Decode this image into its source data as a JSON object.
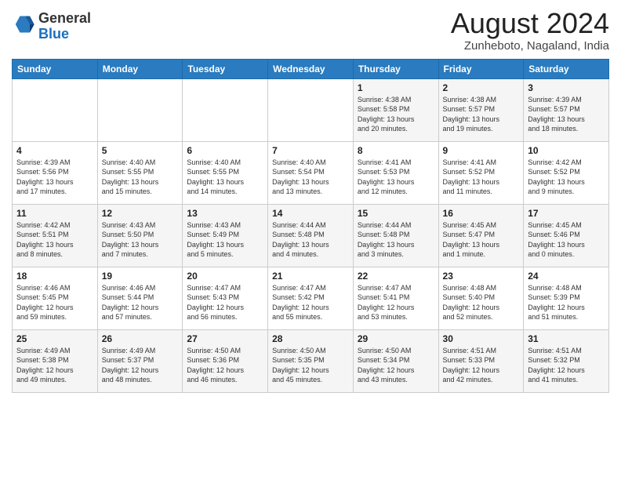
{
  "header": {
    "logo_line1": "General",
    "logo_line2": "Blue",
    "month_year": "August 2024",
    "location": "Zunheboto, Nagaland, India"
  },
  "weekdays": [
    "Sunday",
    "Monday",
    "Tuesday",
    "Wednesday",
    "Thursday",
    "Friday",
    "Saturday"
  ],
  "weeks": [
    [
      {
        "day": "",
        "content": ""
      },
      {
        "day": "",
        "content": ""
      },
      {
        "day": "",
        "content": ""
      },
      {
        "day": "",
        "content": ""
      },
      {
        "day": "1",
        "content": "Sunrise: 4:38 AM\nSunset: 5:58 PM\nDaylight: 13 hours\nand 20 minutes."
      },
      {
        "day": "2",
        "content": "Sunrise: 4:38 AM\nSunset: 5:57 PM\nDaylight: 13 hours\nand 19 minutes."
      },
      {
        "day": "3",
        "content": "Sunrise: 4:39 AM\nSunset: 5:57 PM\nDaylight: 13 hours\nand 18 minutes."
      }
    ],
    [
      {
        "day": "4",
        "content": "Sunrise: 4:39 AM\nSunset: 5:56 PM\nDaylight: 13 hours\nand 17 minutes."
      },
      {
        "day": "5",
        "content": "Sunrise: 4:40 AM\nSunset: 5:55 PM\nDaylight: 13 hours\nand 15 minutes."
      },
      {
        "day": "6",
        "content": "Sunrise: 4:40 AM\nSunset: 5:55 PM\nDaylight: 13 hours\nand 14 minutes."
      },
      {
        "day": "7",
        "content": "Sunrise: 4:40 AM\nSunset: 5:54 PM\nDaylight: 13 hours\nand 13 minutes."
      },
      {
        "day": "8",
        "content": "Sunrise: 4:41 AM\nSunset: 5:53 PM\nDaylight: 13 hours\nand 12 minutes."
      },
      {
        "day": "9",
        "content": "Sunrise: 4:41 AM\nSunset: 5:52 PM\nDaylight: 13 hours\nand 11 minutes."
      },
      {
        "day": "10",
        "content": "Sunrise: 4:42 AM\nSunset: 5:52 PM\nDaylight: 13 hours\nand 9 minutes."
      }
    ],
    [
      {
        "day": "11",
        "content": "Sunrise: 4:42 AM\nSunset: 5:51 PM\nDaylight: 13 hours\nand 8 minutes."
      },
      {
        "day": "12",
        "content": "Sunrise: 4:43 AM\nSunset: 5:50 PM\nDaylight: 13 hours\nand 7 minutes."
      },
      {
        "day": "13",
        "content": "Sunrise: 4:43 AM\nSunset: 5:49 PM\nDaylight: 13 hours\nand 5 minutes."
      },
      {
        "day": "14",
        "content": "Sunrise: 4:44 AM\nSunset: 5:48 PM\nDaylight: 13 hours\nand 4 minutes."
      },
      {
        "day": "15",
        "content": "Sunrise: 4:44 AM\nSunset: 5:48 PM\nDaylight: 13 hours\nand 3 minutes."
      },
      {
        "day": "16",
        "content": "Sunrise: 4:45 AM\nSunset: 5:47 PM\nDaylight: 13 hours\nand 1 minute."
      },
      {
        "day": "17",
        "content": "Sunrise: 4:45 AM\nSunset: 5:46 PM\nDaylight: 13 hours\nand 0 minutes."
      }
    ],
    [
      {
        "day": "18",
        "content": "Sunrise: 4:46 AM\nSunset: 5:45 PM\nDaylight: 12 hours\nand 59 minutes."
      },
      {
        "day": "19",
        "content": "Sunrise: 4:46 AM\nSunset: 5:44 PM\nDaylight: 12 hours\nand 57 minutes."
      },
      {
        "day": "20",
        "content": "Sunrise: 4:47 AM\nSunset: 5:43 PM\nDaylight: 12 hours\nand 56 minutes."
      },
      {
        "day": "21",
        "content": "Sunrise: 4:47 AM\nSunset: 5:42 PM\nDaylight: 12 hours\nand 55 minutes."
      },
      {
        "day": "22",
        "content": "Sunrise: 4:47 AM\nSunset: 5:41 PM\nDaylight: 12 hours\nand 53 minutes."
      },
      {
        "day": "23",
        "content": "Sunrise: 4:48 AM\nSunset: 5:40 PM\nDaylight: 12 hours\nand 52 minutes."
      },
      {
        "day": "24",
        "content": "Sunrise: 4:48 AM\nSunset: 5:39 PM\nDaylight: 12 hours\nand 51 minutes."
      }
    ],
    [
      {
        "day": "25",
        "content": "Sunrise: 4:49 AM\nSunset: 5:38 PM\nDaylight: 12 hours\nand 49 minutes."
      },
      {
        "day": "26",
        "content": "Sunrise: 4:49 AM\nSunset: 5:37 PM\nDaylight: 12 hours\nand 48 minutes."
      },
      {
        "day": "27",
        "content": "Sunrise: 4:50 AM\nSunset: 5:36 PM\nDaylight: 12 hours\nand 46 minutes."
      },
      {
        "day": "28",
        "content": "Sunrise: 4:50 AM\nSunset: 5:35 PM\nDaylight: 12 hours\nand 45 minutes."
      },
      {
        "day": "29",
        "content": "Sunrise: 4:50 AM\nSunset: 5:34 PM\nDaylight: 12 hours\nand 43 minutes."
      },
      {
        "day": "30",
        "content": "Sunrise: 4:51 AM\nSunset: 5:33 PM\nDaylight: 12 hours\nand 42 minutes."
      },
      {
        "day": "31",
        "content": "Sunrise: 4:51 AM\nSunset: 5:32 PM\nDaylight: 12 hours\nand 41 minutes."
      }
    ]
  ]
}
